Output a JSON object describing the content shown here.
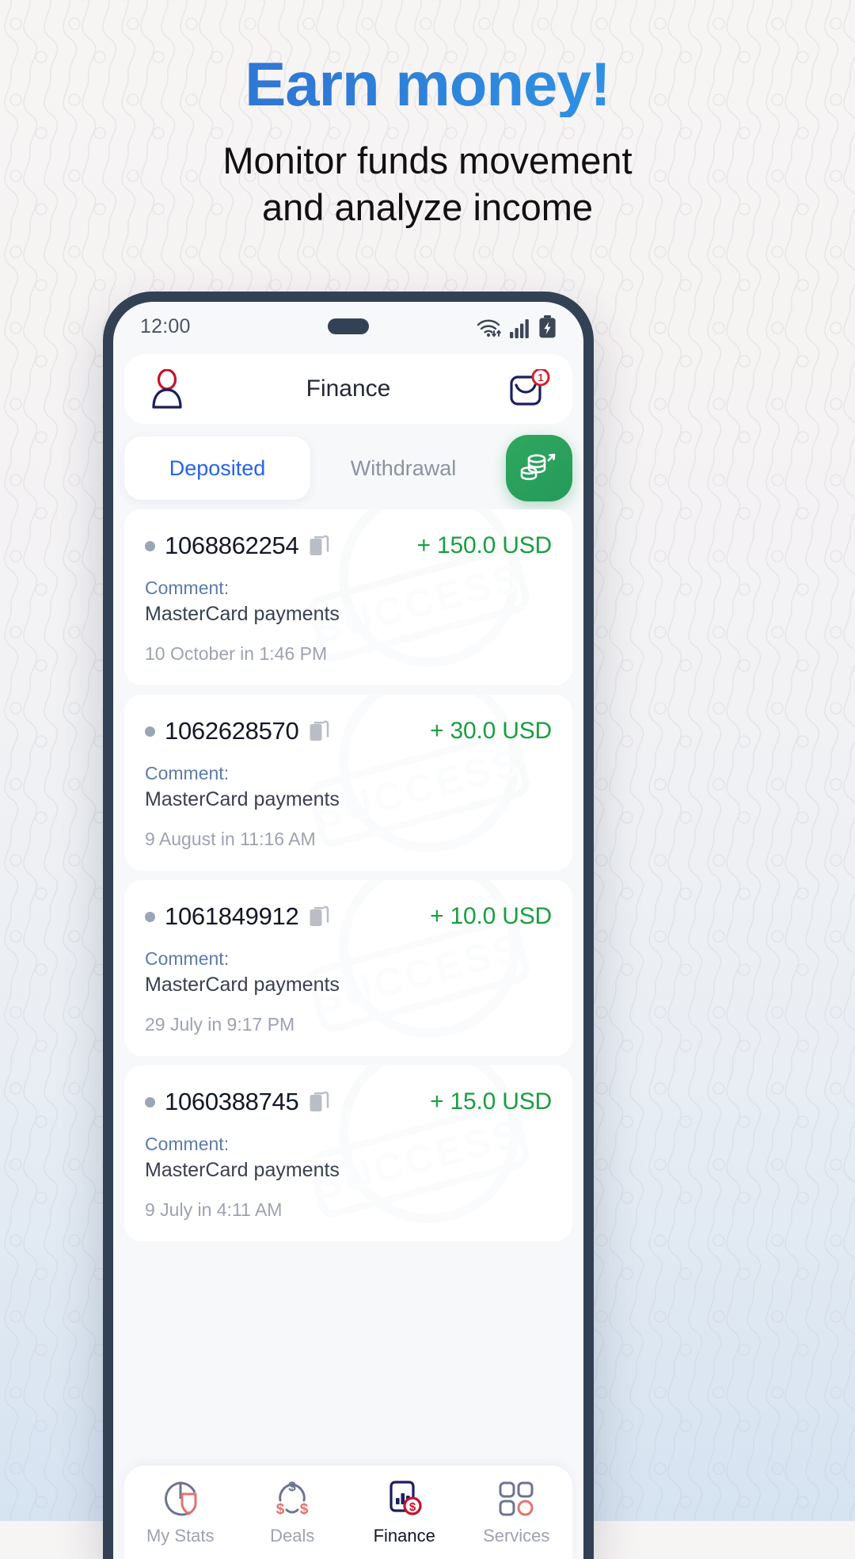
{
  "promo": {
    "headline": "Earn money!",
    "subline_1": "Monitor funds movement",
    "subline_2": "and analyze income",
    "headline_color": "#2f7ad6",
    "subline_color": "#111111"
  },
  "phone": {
    "frame_color": "#334155",
    "status_bar": {
      "clock": "12:00",
      "wifi_icon": "wifi-icon",
      "signal_icon": "signal-bars-icon",
      "battery_icon": "battery-charging-icon"
    },
    "app_bar": {
      "title": "Finance",
      "profile_icon": "profile-icon",
      "mail_icon": "mail-icon",
      "mail_badge": "1",
      "badge_color": "#d61f2b"
    },
    "tabs": {
      "items": [
        {
          "label": "Deposited",
          "active": true
        },
        {
          "label": "Withdrawal",
          "active": false
        }
      ],
      "active_color": "#2563eb",
      "inactive_color": "#8b93a1",
      "deposit_button": {
        "icon": "coins-deposit-icon",
        "color": "#25995a"
      }
    },
    "transactions": {
      "comment_label": "Comment:",
      "stamp_text": "SUCCESS",
      "amount_color": "#1a9e3f",
      "copy_icon": "copy-icon",
      "items": [
        {
          "id": "1068862254",
          "amount": "+ 150.0 USD",
          "comment": "MasterCard payments",
          "date": "10 October in 1:46 PM"
        },
        {
          "id": "1062628570",
          "amount": "+ 30.0 USD",
          "comment": "MasterCard payments",
          "date": "9 August in 11:16 AM"
        },
        {
          "id": "1061849912",
          "amount": "+ 10.0 USD",
          "comment": "MasterCard payments",
          "date": "29 July in 9:17 PM"
        },
        {
          "id": "1060388745",
          "amount": "+ 15.0 USD",
          "comment": "MasterCard payments",
          "date": "9 July in 4:11 AM"
        }
      ]
    },
    "bottom_nav": {
      "items": [
        {
          "label": "My Stats",
          "icon": "pie-shield-icon",
          "active": false
        },
        {
          "label": "Deals",
          "icon": "exchange-dollar-icon",
          "active": false
        },
        {
          "label": "Finance",
          "icon": "chart-dollar-icon",
          "active": true
        },
        {
          "label": "Services",
          "icon": "grid-apps-icon",
          "active": false
        }
      ]
    }
  }
}
